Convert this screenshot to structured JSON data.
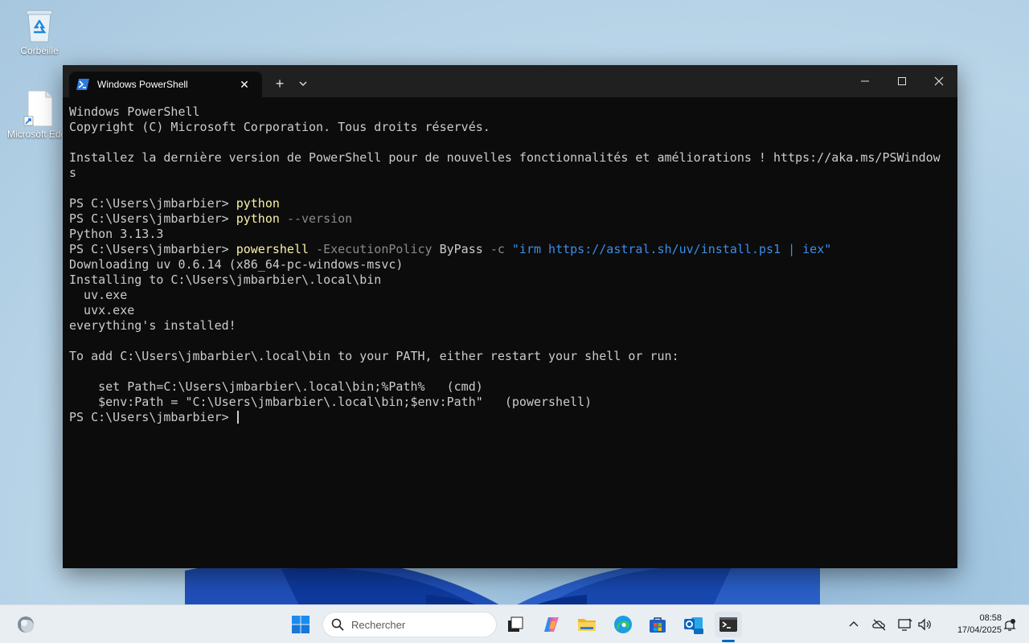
{
  "desktop": {
    "icons": [
      {
        "label": "Corbeille",
        "icon": "recycle-bin-icon"
      },
      {
        "label": "Microsoft Edge",
        "icon": "shortcut-file-icon"
      }
    ]
  },
  "window": {
    "tab_title": "Windows PowerShell",
    "tab_icon": "powershell-icon",
    "new_tab_symbol": "+",
    "close_tab_symbol": "✕"
  },
  "console": {
    "line1": "Windows PowerShell",
    "line2": "Copyright (C) Microsoft Corporation. Tous droits réservés.",
    "line3": "Installez la dernière version de PowerShell pour de nouvelles fonctionnalités et améliorations ! https://aka.ms/PSWindow",
    "line4": "s",
    "prompt": "PS C:\\Users\\jmbarbier> ",
    "cmd_python": "python",
    "param_version": "--version",
    "python_version": "Python 3.13.3",
    "cmd_powershell": "powershell",
    "param_exec": "-ExecutionPolicy",
    "bypass": "ByPass",
    "param_c": "-c",
    "install_string": "\"irm https://astral.sh/uv/install.ps1 | iex\"",
    "downloading": "Downloading uv 0.6.14 (x86_64-pc-windows-msvc)",
    "installing_to": "Installing to C:\\Users\\jmbarbier\\.local\\bin",
    "uv_exe": "  uv.exe",
    "uvx_exe": "  uvx.exe",
    "everything": "everything's installed!",
    "to_add": "To add C:\\Users\\jmbarbier\\.local\\bin to your PATH, either restart your shell or run:",
    "set_path": "    set Path=C:\\Users\\jmbarbier\\.local\\bin;%Path%   (cmd)",
    "env_path": "    $env:Path = \"C:\\Users\\jmbarbier\\.local\\bin;$env:Path\"   (powershell)"
  },
  "taskbar": {
    "search_placeholder": "Rechercher",
    "apps": [
      "widgets-icon",
      "start-icon",
      "task-view-icon",
      "copilot-icon",
      "file-explorer-icon",
      "edge-icon",
      "store-icon",
      "outlook-icon",
      "terminal-icon"
    ],
    "time": "08:58",
    "date": "17/04/2025"
  },
  "colors": {
    "terminal_bg": "#0c0c0c",
    "command": "#f9f1a5",
    "parameter": "#8a8a8a",
    "string": "#3b8eea",
    "accent": "#0067c0"
  }
}
